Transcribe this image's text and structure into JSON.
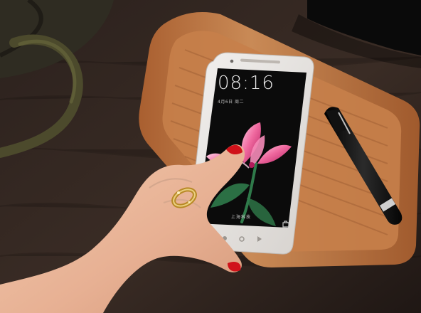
{
  "lockscreen": {
    "time": "08:16",
    "date": "4月6日 周二",
    "location": "上海科技"
  },
  "icons": {
    "left": "fingerprint-icon",
    "right": "camera-icon"
  },
  "colors": {
    "table": "#3a2b24",
    "tray": "#b9743f",
    "phone_body": "#e9e6e3",
    "screen": "#0b0b0b",
    "flower": "#f06aa0",
    "stem": "#2f7a4a",
    "nail": "#d0121a"
  }
}
